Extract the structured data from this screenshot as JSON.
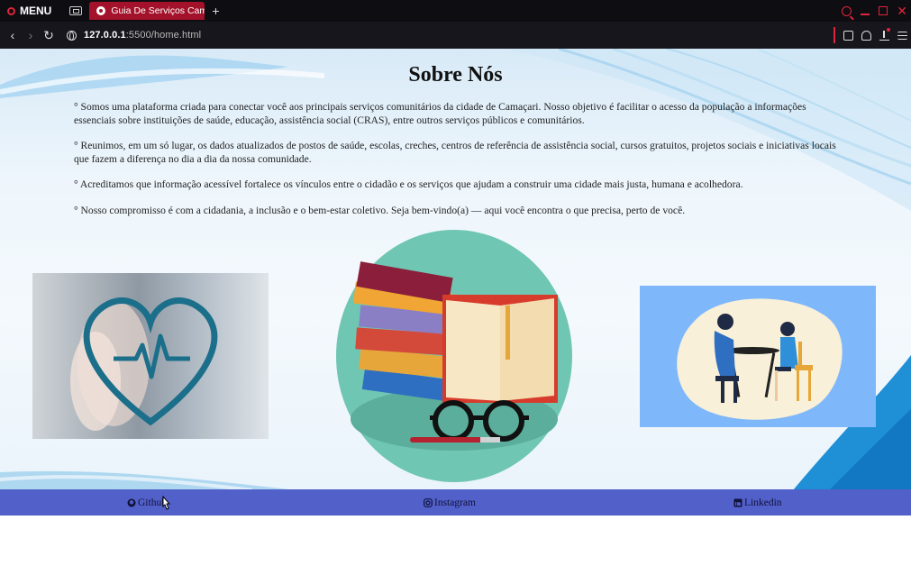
{
  "browser": {
    "menu_label": "MENU",
    "tab_title": "Guia De Serviços Camaça",
    "new_tab_label": "+",
    "url_host": "127.0.0.1",
    "url_rest": ":5500/home.html"
  },
  "page": {
    "title": "Sobre Nós",
    "paragraphs": [
      "° Somos uma plataforma criada para conectar você aos principais serviços comunitários da cidade de Camaçari. Nosso objetivo é facilitar o acesso da população a informações essenciais sobre instituições de saúde, educação, assistência social (CRAS), entre outros serviços públicos e comunitários.",
      "° Reunimos, em um só lugar, os dados atualizados de postos de saúde, escolas, creches, centros de referência de assistência social, cursos gratuitos, projetos sociais e iniciativas locais que fazem a diferença no dia a dia da nossa comunidade.",
      "° Acreditamos que informação acessível fortalece os vínculos entre o cidadão e os serviços que ajudam a construir uma cidade mais justa, humana e acolhedora.",
      "° Nosso compromisso é com a cidadania, a inclusão e o bem-estar coletivo. Seja bem-vindo(a) — aqui você encontra o que precisa, perto de você."
    ]
  },
  "footer": {
    "links": [
      {
        "label": "Github",
        "icon": "github-icon"
      },
      {
        "label": "Instagram",
        "icon": "instagram-icon"
      },
      {
        "label": "Linkedin",
        "icon": "linkedin-icon"
      }
    ],
    "color": "#5260c9"
  }
}
